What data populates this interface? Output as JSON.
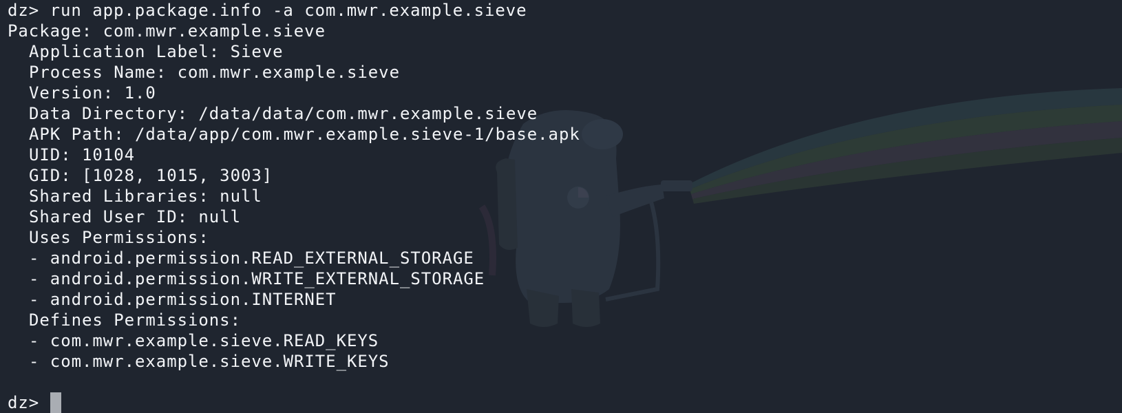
{
  "colors": {
    "background": "#1f252f",
    "text": "#f2f4f7",
    "cursor": "#a9adb3"
  },
  "watermark_icon": "drozer-mascot-icon",
  "command": {
    "prompt": "dz>",
    "text": "run app.package.info -a com.mwr.example.sieve"
  },
  "output": {
    "package": "Package: com.mwr.example.sieve",
    "details": [
      "Application Label: Sieve",
      "Process Name: com.mwr.example.sieve",
      "Version: 1.0",
      "Data Directory: /data/data/com.mwr.example.sieve",
      "APK Path: /data/app/com.mwr.example.sieve-1/base.apk",
      "UID: 10104",
      "GID: [1028, 1015, 3003]",
      "Shared Libraries: null",
      "Shared User ID: null"
    ],
    "uses_permissions_header": "Uses Permissions:",
    "uses_permissions": [
      "- android.permission.READ_EXTERNAL_STORAGE",
      "- android.permission.WRITE_EXTERNAL_STORAGE",
      "- android.permission.INTERNET"
    ],
    "defines_permissions_header": "Defines Permissions:",
    "defines_permissions": [
      "- com.mwr.example.sieve.READ_KEYS",
      "- com.mwr.example.sieve.WRITE_KEYS"
    ]
  },
  "input_prompt": "dz>"
}
